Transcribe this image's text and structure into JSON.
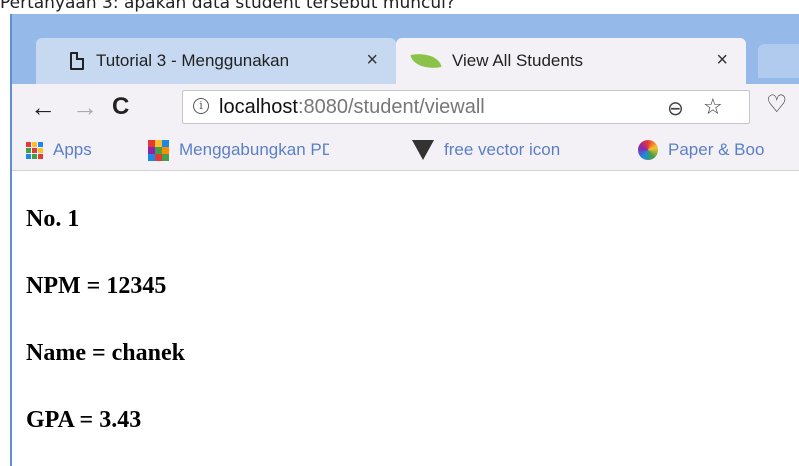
{
  "caption": "Pertanyaan 3: apakah data student tersebut muncul?",
  "tabs": [
    {
      "title": "Tutorial 3 - Menggunakan",
      "close": "×"
    },
    {
      "title": "View All Students",
      "close": "×"
    }
  ],
  "nav": {
    "back": "←",
    "forward": "→",
    "reload": "C"
  },
  "address": {
    "host": "localhost",
    "rest": ":8080/student/viewall",
    "info": "i"
  },
  "icons": {
    "zoom": "⊖",
    "star": "☆",
    "heart": "♡"
  },
  "bookmarks": [
    {
      "label": "Apps"
    },
    {
      "label": "Menggabungkan PDF"
    },
    {
      "label": "free vector icon"
    },
    {
      "label": "Paper & Boo"
    }
  ],
  "student": {
    "number": "No. 1",
    "npm": "NPM = 12345",
    "name": "Name = chanek",
    "gpa": "GPA = 3.43"
  },
  "colors": {
    "tabstrip": "#95b9e8",
    "active_tab": "#f3f1f5",
    "bookmark_text": "#5b7fc7"
  }
}
